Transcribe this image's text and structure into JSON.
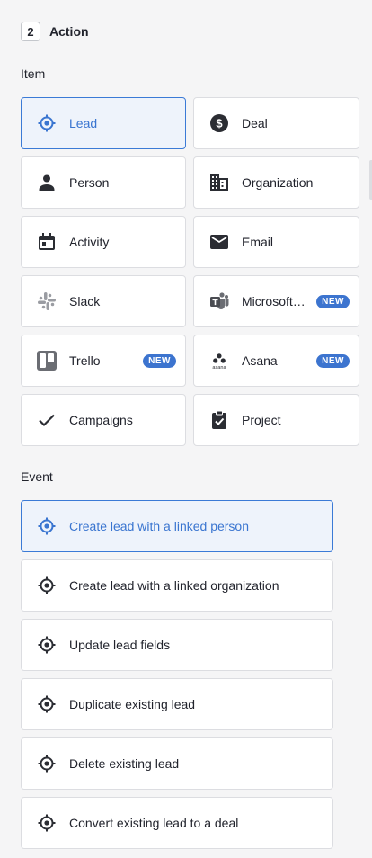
{
  "step": {
    "number": "2",
    "title": "Action"
  },
  "item_section": {
    "label": "Item",
    "tiles": [
      {
        "label": "Lead",
        "icon": "lead-target-icon",
        "selected": true
      },
      {
        "label": "Deal",
        "icon": "dollar-icon"
      },
      {
        "label": "Person",
        "icon": "person-icon"
      },
      {
        "label": "Organization",
        "icon": "building-icon"
      },
      {
        "label": "Activity",
        "icon": "calendar-icon"
      },
      {
        "label": "Email",
        "icon": "envelope-icon"
      },
      {
        "label": "Slack",
        "icon": "slack-logo-icon"
      },
      {
        "label": "Microsoft…",
        "icon": "teams-logo-icon",
        "badge": "NEW"
      },
      {
        "label": "Trello",
        "icon": "trello-logo-icon",
        "badge": "NEW"
      },
      {
        "label": "Asana",
        "icon": "asana-logo-icon",
        "badge": "NEW"
      },
      {
        "label": "Campaigns",
        "icon": "checkmark-icon"
      },
      {
        "label": "Project",
        "icon": "clipboard-check-icon"
      }
    ]
  },
  "event_section": {
    "label": "Event",
    "events": [
      {
        "label": "Create lead with a linked person",
        "selected": true
      },
      {
        "label": "Create lead with a linked organization"
      },
      {
        "label": "Update lead fields"
      },
      {
        "label": "Duplicate existing lead"
      },
      {
        "label": "Delete existing lead"
      },
      {
        "label": "Convert existing lead to a deal"
      }
    ]
  },
  "colors": {
    "accent": "#3a75d0",
    "selected_bg": "#eef3fb",
    "badge_bg": "#3c74cf"
  }
}
